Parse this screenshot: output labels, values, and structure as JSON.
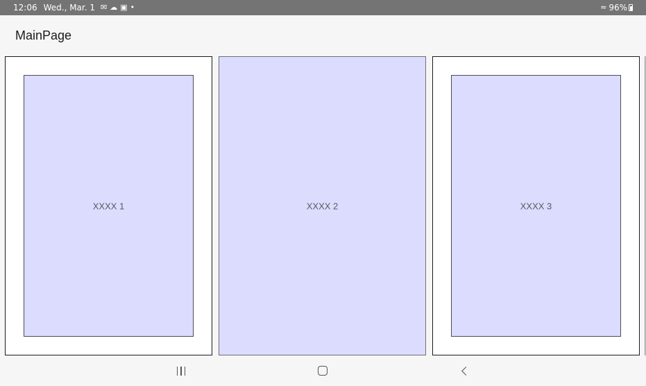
{
  "status_bar": {
    "time": "12:06",
    "date": "Wed., Mar. 1",
    "battery_level": "96%",
    "notification_icons": [
      "gmail-icon",
      "cloud-icon",
      "message-icon",
      "dot-icon"
    ],
    "connectivity_icons": [
      "wifi-icon",
      "battery-icon"
    ]
  },
  "app_bar": {
    "title": "MainPage"
  },
  "carousel": {
    "items": [
      {
        "label": "XXXX 1",
        "selected": false
      },
      {
        "label": "XXXX 2",
        "selected": true
      },
      {
        "label": "XXXX 3",
        "selected": false
      }
    ]
  },
  "navigation_bar": {
    "buttons": [
      "recents-icon",
      "home-icon",
      "back-icon"
    ]
  },
  "colors": {
    "status_bar_bg": "#747474",
    "page_bg": "#f6f6f6",
    "card_fill": "#dcdcff",
    "card_frame": "#ffffff"
  }
}
